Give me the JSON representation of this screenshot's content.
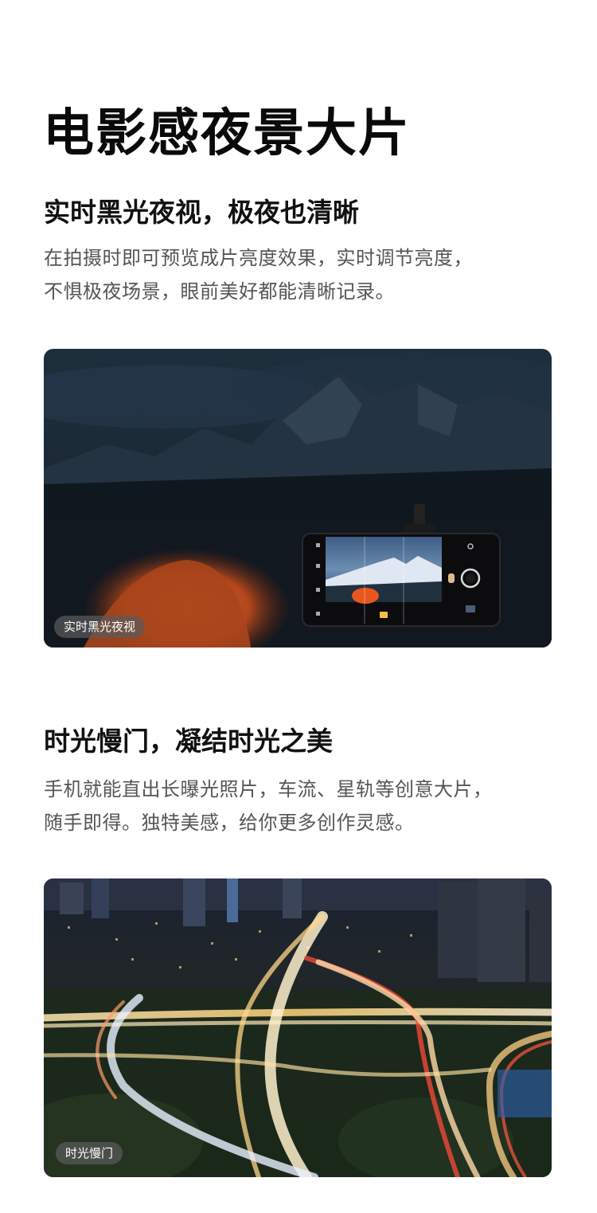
{
  "page": {
    "title": "电影感夜景大片"
  },
  "sections": [
    {
      "heading": "实时黑光夜视，极夜也清晰",
      "body_line1": "在拍摄时即可预览成片亮度效果，实时调节亮度，",
      "body_line2": "不惧极夜场景，眼前美好都能清晰记录。",
      "badge": "实时黑光夜视",
      "image": "night-mountain-tent-with-phone-preview"
    },
    {
      "heading": "时光慢门，凝结时光之美",
      "body_line1": "手机就能直出长曝光照片，车流、星轨等创意大片，",
      "body_line2": "随手即得。独特美感，给你更多创作灵感。",
      "badge": "时光慢门",
      "image": "night-city-interchange-light-trails"
    }
  ]
}
